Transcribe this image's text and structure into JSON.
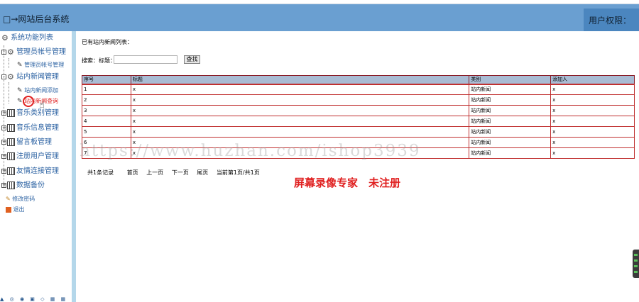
{
  "header": {
    "title": "□→网站后台系统",
    "permission_label": "用户权限："
  },
  "sidebar": {
    "root": "系统功能列表",
    "groups": [
      {
        "label": "管理员帐号管理",
        "items": [
          "管理员帐号管理"
        ]
      },
      {
        "label": "站内新闻管理",
        "items": [
          "站内新闻添加",
          "站内新闻查询"
        ]
      },
      {
        "label": "音乐类别管理"
      },
      {
        "label": "音乐信息管理"
      },
      {
        "label": "留言板管理"
      },
      {
        "label": "注册用户管理"
      },
      {
        "label": "友情连接管理"
      },
      {
        "label": "数据备份"
      }
    ],
    "change_password": "修改密码",
    "logout": "退出",
    "bottom_icons": "▲ ◎ ◉ ▣ ◇ ▦ ▦"
  },
  "main": {
    "list_title": "已有站内新闻列表：",
    "search_label": "搜索：标题：",
    "search_value": "",
    "search_button": "查找",
    "table": {
      "headers": [
        "序号",
        "标题",
        "类别",
        "添加人"
      ],
      "rows": [
        [
          "1",
          "x",
          "站内新闻",
          "x"
        ],
        [
          "2",
          "x",
          "站内新闻",
          "x"
        ],
        [
          "3",
          "x",
          "站内新闻",
          "x"
        ],
        [
          "4",
          "x",
          "站内新闻",
          "x"
        ],
        [
          "5",
          "x",
          "站内新闻",
          "x"
        ],
        [
          "6",
          "x",
          "站内新闻",
          "x"
        ],
        [
          "7",
          "x",
          "站内新闻",
          "x"
        ]
      ]
    },
    "pager": {
      "total": "共1条记录",
      "first": "首页",
      "prev": "上一页",
      "next": "下一页",
      "last": "尾页",
      "current": "当前第1页/共1页"
    }
  },
  "overlay": {
    "watermark": "https://www.huzhan.com/ishop3939",
    "registration_notice": "屏幕录像专家　未注册"
  },
  "colors": {
    "header_bg": "#6a9fd1",
    "permission_bg": "#4b86bf",
    "sidebar_border": "#b4d7ea",
    "table_header_bg": "#a9bcd4",
    "table_border": "#c03030",
    "notice_red": "#e02020"
  }
}
